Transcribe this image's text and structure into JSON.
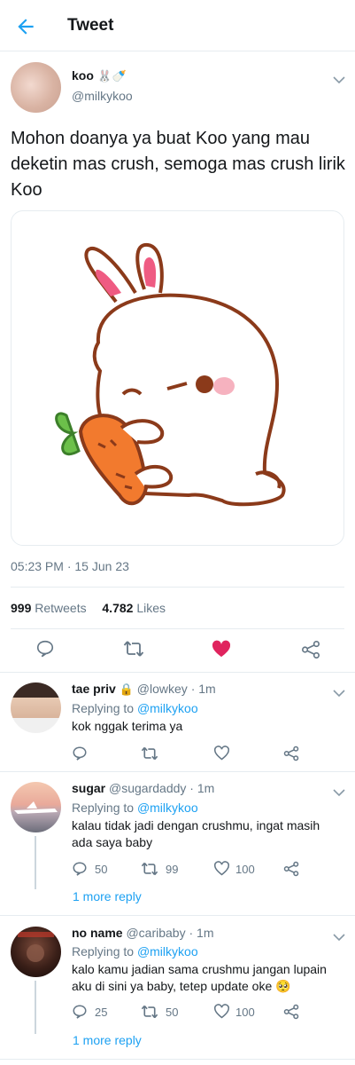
{
  "header": {
    "title": "Tweet"
  },
  "tweet": {
    "author_name": "koo",
    "author_emoji": "🐰🍼",
    "handle": "@milkykoo",
    "text": "Mohon doanya ya buat Koo yang mau deketin mas crush, semoga mas crush lirik Koo",
    "time": "05:23 PM",
    "date_sep": "·",
    "date": "15 Jun 23",
    "retweets": "999",
    "retweets_label": "Retweets",
    "likes": "4.782",
    "likes_label": "Likes",
    "liked": true
  },
  "colors": {
    "accent": "#1da1f2",
    "like": "#e0245e",
    "muted": "#657786",
    "border": "#e6ecf0"
  },
  "replies": [
    {
      "name": "tae priv",
      "name_icon": "lock-icon",
      "handle": "@lowkey",
      "time": "· 1m",
      "replying_label": "Replying to",
      "replying_handle": "@milkykoo",
      "text": "kok nggak terima ya",
      "reply_count": "",
      "retweet_count": "",
      "like_count": "",
      "more": ""
    },
    {
      "name": "sugar",
      "handle": "@sugardaddy",
      "time": "· 1m",
      "replying_label": "Replying to",
      "replying_handle": "@milkykoo",
      "text": "kalau tidak jadi dengan crushmu, ingat masih ada saya baby",
      "reply_count": "50",
      "retweet_count": "99",
      "like_count": "100",
      "more": "1 more reply"
    },
    {
      "name": "no name",
      "handle": "@caribaby",
      "time": "· 1m",
      "replying_label": "Replying to",
      "replying_handle": "@milkykoo",
      "text": "kalo kamu jadian sama crushmu jangan lupain aku di sini ya baby, tetep update oke 🥺",
      "reply_count": "25",
      "retweet_count": "50",
      "like_count": "100",
      "more": "1 more reply"
    }
  ]
}
